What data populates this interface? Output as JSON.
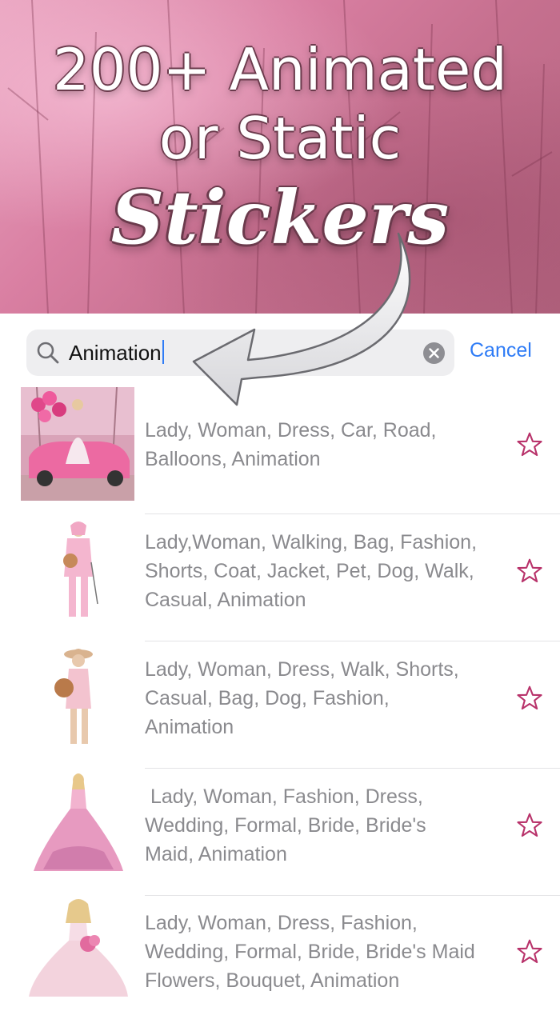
{
  "promo": {
    "line1": "200+ Animated",
    "line2": "or Static",
    "line3": "Stickers"
  },
  "search": {
    "value": "Animation",
    "cancel_label": "Cancel"
  },
  "results": [
    {
      "tags": "Lady, Woman, Dress, Car, Road,\nBalloons, Animation",
      "favorite": false
    },
    {
      "tags": "Lady,Woman, Walking, Bag, Fashion,\nShorts, Coat, Jacket, Pet, Dog, Walk,\nCasual, Animation",
      "favorite": false
    },
    {
      "tags": "Lady, Woman, Dress, Walk, Shorts,\nCasual, Bag, Dog, Fashion,\nAnimation",
      "favorite": false
    },
    {
      "tags": " Lady, Woman, Fashion, Dress,\nWedding, Formal, Bride, Bride's\nMaid, Animation",
      "favorite": false
    },
    {
      "tags": "Lady, Woman, Dress, Fashion,\nWedding, Formal, Bride, Bride's Maid\nFlowers, Bouquet, Animation",
      "favorite": false
    }
  ],
  "colors": {
    "accent": "#2f7cf6",
    "star": "#b8326a",
    "hero_pink": "#d97fa2"
  }
}
